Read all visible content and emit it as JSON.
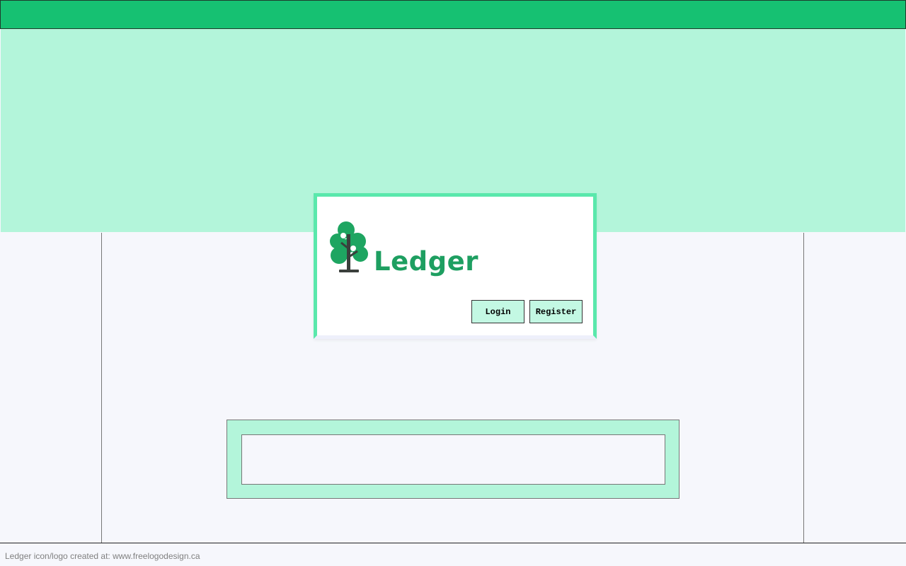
{
  "app": {
    "logo_text": "Ledger",
    "logo_icon": "tree-icon"
  },
  "auth": {
    "login_label": "Login",
    "register_label": "Register"
  },
  "footer": {
    "credit": "Ledger icon/logo created at: www.freelogodesign.ca"
  },
  "colors": {
    "topbar": "#16c172",
    "hero": "#b3f5da",
    "accent": "#5ae8ac",
    "brand_text": "#1e9f61",
    "button_bg": "#c3f8e3",
    "page_bg": "#f6f7fc"
  }
}
